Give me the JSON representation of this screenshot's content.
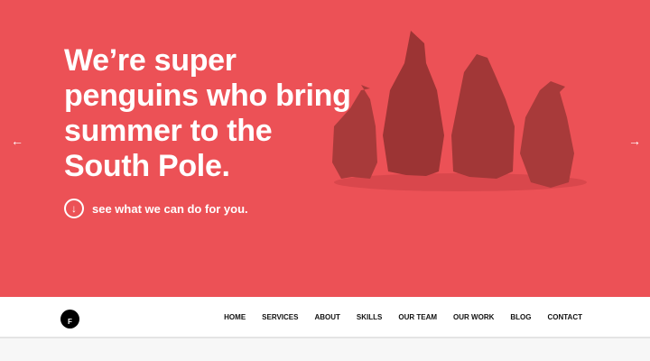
{
  "hero": {
    "headline": "We’re super penguins who bring summer to the South Pole.",
    "cta": "see what we can do for you.",
    "prev_icon": "arrow-left-icon",
    "next_icon": "arrow-right-icon",
    "bg_color": "#ec5156"
  },
  "nav": {
    "logo_letter": "F",
    "items": [
      "HOME",
      "SERVICES",
      "ABOUT",
      "SKILLS",
      "OUR TEAM",
      "OUR WORK",
      "BLOG",
      "CONTACT"
    ]
  }
}
